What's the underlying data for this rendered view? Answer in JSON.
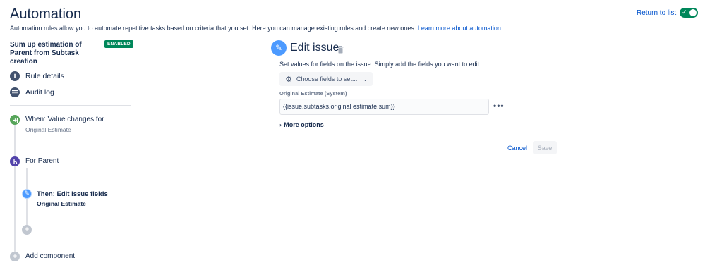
{
  "header": {
    "title": "Automation",
    "return_link": "Return to list",
    "toggle_enabled": true
  },
  "description": {
    "text": "Automation rules allow you to automate repetitive tasks based on criteria that you set. Here you can manage existing rules and create new ones.",
    "link": "Learn more about automation"
  },
  "rule": {
    "name": "Sum up estimation of Parent from Subtask creation",
    "status_badge": "ENABLED"
  },
  "nav": {
    "rule_details": "Rule details",
    "audit_log": "Audit log"
  },
  "flow": {
    "trigger_title": "When: Value changes for",
    "trigger_sub": "Original Estimate",
    "branch_title": "For Parent",
    "action_title": "Then: Edit issue fields",
    "action_sub": "Original Estimate",
    "add_component": "Add component"
  },
  "panel": {
    "title": "Edit issue",
    "description": "Set values for fields on the issue. Simply add the fields you want to edit.",
    "choose_fields": "Choose fields to set...",
    "field_label": "Original Estimate (System)",
    "field_value": "{{issue.subtasks.original estimate.sum}}",
    "more_options": "More options",
    "cancel": "Cancel",
    "save": "Save"
  },
  "colors": {
    "accent": "#0052cc",
    "enabled_green": "#00875a",
    "trigger_green": "#57a55a",
    "branch_purple": "#5243aa",
    "action_blue": "#4c9aff",
    "nav_icon": "#42526e"
  },
  "icons": {
    "rule_details": "info-icon",
    "audit_log": "list-icon",
    "trigger": "trigger-icon",
    "branch": "branch-icon",
    "action": "pencil-icon",
    "add": "plus-icon",
    "delete": "trash-icon",
    "settings": "gear-icon"
  }
}
